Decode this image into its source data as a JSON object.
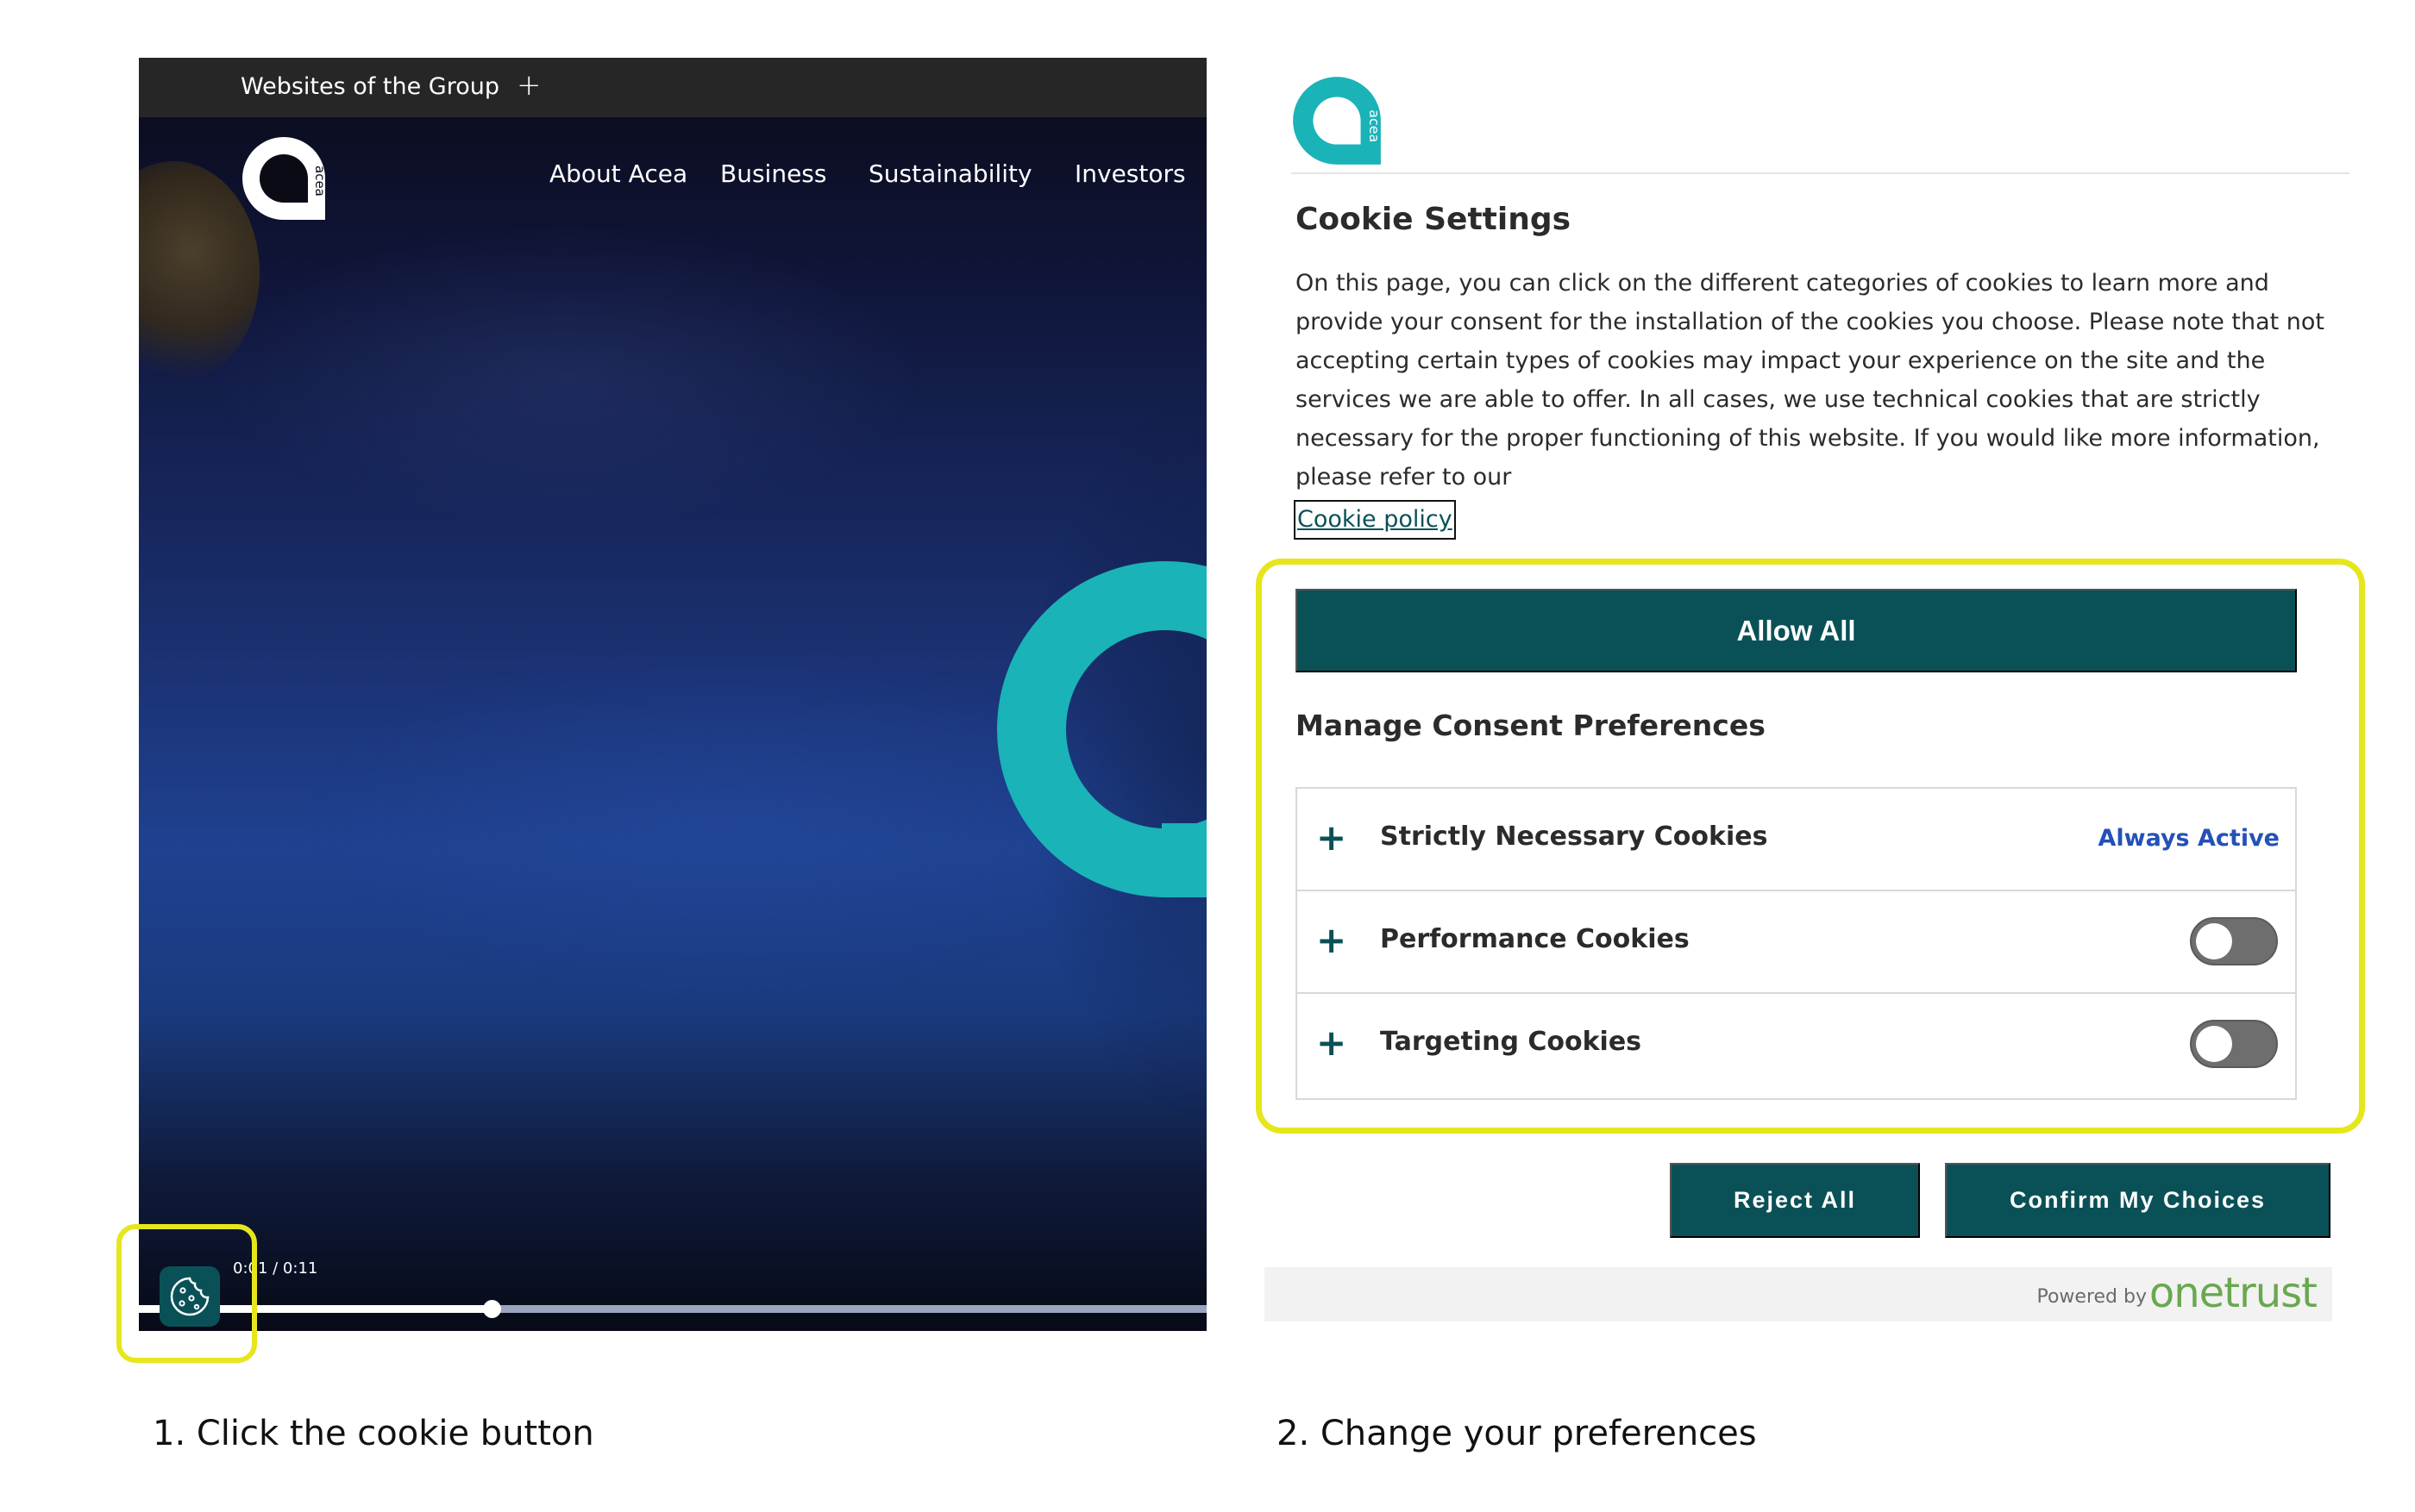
{
  "colors": {
    "brand_teal": "#1ab3b8",
    "button_dark": "#0a5157",
    "highlight": "#e6e61d",
    "always_active": "#2451b8",
    "onetrust_green": "#6aa84f"
  },
  "site": {
    "topbar_label": "Websites of the Group",
    "topbar_plus": "+",
    "logo_text": "acea",
    "nav": [
      "About Acea",
      "Business",
      "Sustainability",
      "Investors"
    ],
    "video_time": "0:01 / 0:11",
    "video_progress": 0.33,
    "cookie_icon": "cookie-icon"
  },
  "panel": {
    "logo_text": "acea",
    "title": "Cookie Settings",
    "description": "On this page, you can click on the different categories of cookies to learn more and provide your consent for the installation of the cookies you choose. Please note that not accepting certain types of cookies may impact your experience on the site and the services we are able to offer. In all cases, we use technical cookies that are strictly necessary for the proper functioning of this website. If you would like more information, please refer to our",
    "link": "Cookie policy",
    "allow_all": "Allow All",
    "manage_title": "Manage Consent Preferences",
    "preferences": [
      {
        "label": "Strictly Necessary Cookies",
        "status": "Always Active",
        "enabled": true
      },
      {
        "label": "Performance Cookies",
        "enabled": false
      },
      {
        "label": "Targeting Cookies",
        "enabled": false
      }
    ],
    "reject_all": "Reject All",
    "confirm": "Confirm My Choices",
    "powered_by": "Powered by",
    "powered_brand": "onetrust"
  },
  "captions": {
    "step1": "1. Click the cookie button",
    "step2": "2. Change your preferences"
  }
}
